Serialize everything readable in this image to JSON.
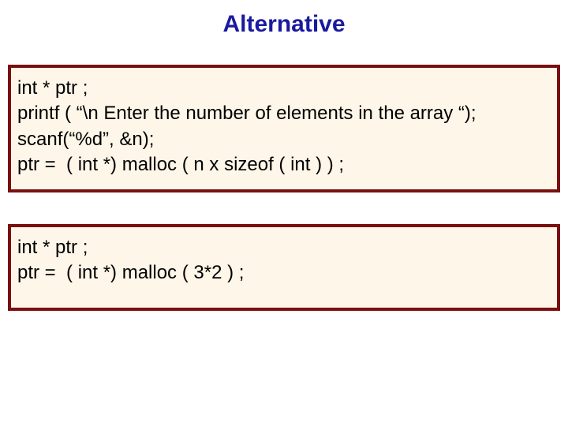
{
  "title": "Alternative",
  "box1": {
    "line1": "int * ptr ;",
    "line2": "printf ( “\\n Enter the number of elements in the array “);",
    "line3": "scanf(“%d”, &n);",
    "line4": "ptr =  ( int *) malloc ( n x sizeof ( int ) ) ;"
  },
  "box2": {
    "line1": "int * ptr ;",
    "line2": "ptr =  ( int *) malloc ( 3*2 ) ;"
  }
}
